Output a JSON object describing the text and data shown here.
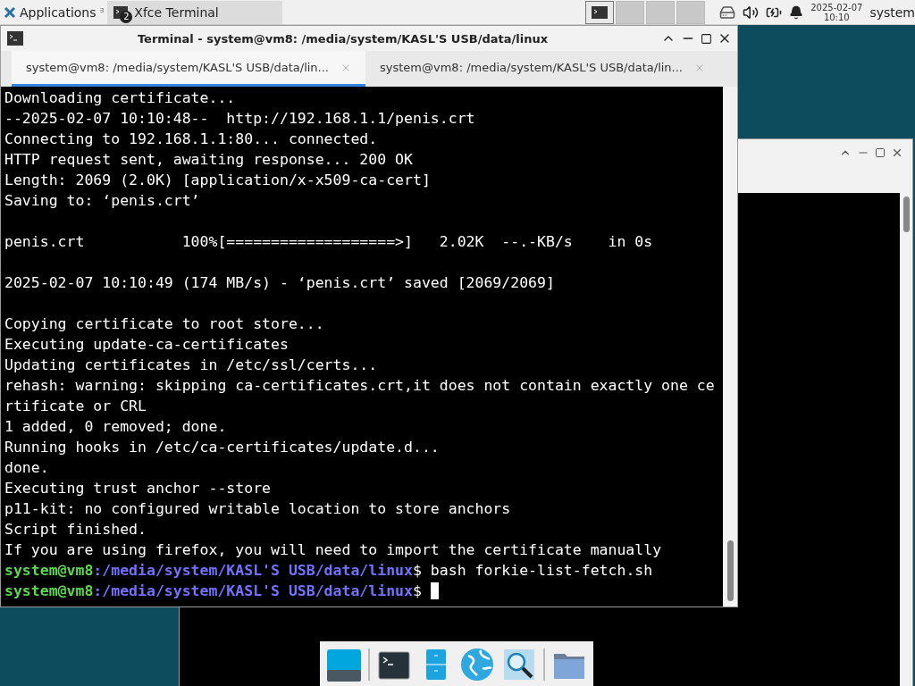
{
  "panel": {
    "menu_label": "Applications",
    "menu_glyph": "ᴲ",
    "tasks": [
      {
        "label": "Xfce Terminal",
        "badge": "2",
        "selected": true
      }
    ],
    "workspaces": [
      {
        "selected": true
      },
      {
        "selected": false
      },
      {
        "selected": false
      },
      {
        "selected": false
      }
    ],
    "clock": {
      "date": "2025-02-07",
      "time": "10:10"
    },
    "user": "system"
  },
  "terminal": {
    "title": "Terminal - system@vm8: /media/system/KASL'S USB/data/linux",
    "tabs": [
      {
        "label": "system@vm8: /media/system/KASL'S USB/data/lin...",
        "selected": true
      },
      {
        "label": "system@vm8: /media/system/KASL'S USB/data/lin...",
        "selected": false
      }
    ],
    "lines": [
      {
        "kind": "text",
        "text": "Downloading certificate..."
      },
      {
        "kind": "text",
        "text": "--2025-02-07 10:10:48--  http://192.168.1.1/penis.crt"
      },
      {
        "kind": "text",
        "text": "Connecting to 192.168.1.1:80... connected."
      },
      {
        "kind": "text",
        "text": "HTTP request sent, awaiting response... 200 OK"
      },
      {
        "kind": "text",
        "text": "Length: 2069 (2.0K) [application/x-x509-ca-cert]"
      },
      {
        "kind": "text",
        "text": "Saving to: ‘penis.crt’"
      },
      {
        "kind": "blank"
      },
      {
        "kind": "text",
        "text": "penis.crt           100%[===================>]   2.02K  --.-KB/s    in 0s"
      },
      {
        "kind": "blank"
      },
      {
        "kind": "text",
        "text": "2025-02-07 10:10:49 (174 MB/s) - ‘penis.crt’ saved [2069/2069]"
      },
      {
        "kind": "blank"
      },
      {
        "kind": "text",
        "text": "Copying certificate to root store..."
      },
      {
        "kind": "text",
        "text": "Executing update-ca-certificates"
      },
      {
        "kind": "text",
        "text": "Updating certificates in /etc/ssl/certs..."
      },
      {
        "kind": "text",
        "text": "rehash: warning: skipping ca-certificates.crt,it does not contain exactly one ce"
      },
      {
        "kind": "text",
        "text": "rtificate or CRL"
      },
      {
        "kind": "text",
        "text": "1 added, 0 removed; done."
      },
      {
        "kind": "text",
        "text": "Running hooks in /etc/ca-certificates/update.d..."
      },
      {
        "kind": "text",
        "text": "done."
      },
      {
        "kind": "text",
        "text": "Executing trust anchor --store"
      },
      {
        "kind": "text",
        "text": "p11-kit: no configured writable location to store anchors"
      },
      {
        "kind": "text",
        "text": "Script finished."
      },
      {
        "kind": "text",
        "text": "If you are using firefox, you will need to import the certificate manually"
      },
      {
        "kind": "prompt",
        "host": "system@vm8",
        "path": ":/media/system/KASL'S USB/data/linux",
        "command": "$ bash forkie-list-fetch.sh",
        "cursor": false
      },
      {
        "kind": "prompt",
        "host": "system@vm8",
        "path": ":/media/system/KASL'S USB/data/linux",
        "command": "$ ",
        "cursor": true
      }
    ]
  },
  "dock": [
    {
      "kind": "desktop"
    },
    {
      "kind": "separator"
    },
    {
      "kind": "terminal"
    },
    {
      "kind": "cabinet"
    },
    {
      "kind": "globe"
    },
    {
      "kind": "search"
    },
    {
      "kind": "separator"
    },
    {
      "kind": "folder"
    }
  ]
}
